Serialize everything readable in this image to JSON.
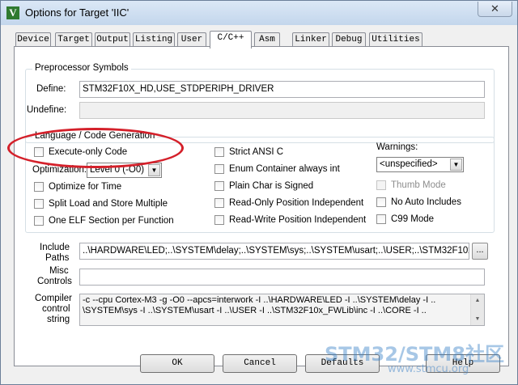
{
  "window": {
    "title": "Options for Target 'IIC'",
    "close_glyph": "✕"
  },
  "tabs": [
    {
      "label": "Device"
    },
    {
      "label": "Target"
    },
    {
      "label": "Output"
    },
    {
      "label": "Listing"
    },
    {
      "label": "User"
    },
    {
      "label": "C/C++"
    },
    {
      "label": "Asm"
    },
    {
      "label": "Linker"
    },
    {
      "label": "Debug"
    },
    {
      "label": "Utilities"
    }
  ],
  "active_tab": "C/C++",
  "preprocessor": {
    "group_title": "Preprocessor Symbols",
    "define_label": "Define:",
    "define_value": "STM32F10X_HD,USE_STDPERIPH_DRIVER",
    "undefine_label": "Undefine:",
    "undefine_value": ""
  },
  "language": {
    "group_title": "Language / Code Generation",
    "execute_only_code": "Execute-only Code",
    "optimization_label": "Optimization:",
    "optimization_value": "Level 0 (-O0)",
    "optimize_for_time": "Optimize for Time",
    "split_load_store": "Split Load and Store Multiple",
    "one_elf_section": "One ELF Section per Function",
    "strict_ansi_c": "Strict ANSI C",
    "enum_container": "Enum Container always int",
    "plain_char_signed": "Plain Char is Signed",
    "readonly_position": "Read-Only Position Independent",
    "readwrite_position": "Read-Write Position Independent",
    "warnings_label": "Warnings:",
    "warnings_value": "<unspecified>",
    "thumb_mode": "Thumb Mode",
    "no_auto_includes": "No Auto Includes",
    "c99_mode": "C99 Mode"
  },
  "include_paths": {
    "label_line1": "Include",
    "label_line2": "Paths",
    "value": "..\\HARDWARE\\LED;..\\SYSTEM\\delay;..\\SYSTEM\\sys;..\\SYSTEM\\usart;..\\USER;..\\STM32F10x_F",
    "browse_label": "..."
  },
  "misc_controls": {
    "label_line1": "Misc",
    "label_line2": "Controls",
    "value": ""
  },
  "compiler_control": {
    "label_line1": "Compiler",
    "label_line2": "control",
    "label_line3": "string",
    "line1": "-c --cpu Cortex-M3 -g -O0 --apcs=interwork -I ..\\HARDWARE\\LED -I ..\\SYSTEM\\delay -I ..",
    "line2": "\\SYSTEM\\sys -I ..\\SYSTEM\\usart -I ..\\USER -I ..\\STM32F10x_FWLib\\inc -I ..\\CORE -I .."
  },
  "buttons": {
    "ok": "OK",
    "cancel": "Cancel",
    "defaults": "Defaults",
    "help": "Help"
  },
  "watermark": {
    "main": "STM32/STM8社区",
    "sub": "www.stmcu.org"
  },
  "colors": {
    "highlight_ellipse": "#d4202a",
    "watermark": "#3c82c8"
  }
}
